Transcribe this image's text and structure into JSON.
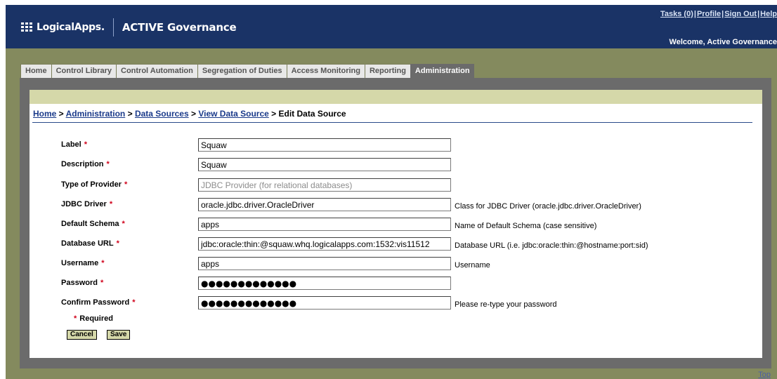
{
  "header": {
    "logo_text": "LogicalApps.",
    "product": "ACTIVE Governance",
    "links": [
      "Tasks (0)",
      "Profile",
      "Sign Out",
      "Help"
    ],
    "separator": "|",
    "welcome": "Welcome, Active Governance"
  },
  "tabs": [
    {
      "label": "Home",
      "active": false
    },
    {
      "label": "Control Library",
      "active": false
    },
    {
      "label": "Control Automation",
      "active": false
    },
    {
      "label": "Segregation of Duties",
      "active": false
    },
    {
      "label": "Access Monitoring",
      "active": false
    },
    {
      "label": "Reporting",
      "active": false
    },
    {
      "label": "Administration",
      "active": true
    }
  ],
  "breadcrumb": {
    "home": "Home",
    "administration": "Administration",
    "data_sources": "Data Sources",
    "view_data_source": "View Data Source",
    "current": "Edit Data Source",
    "sep": " > "
  },
  "form": {
    "required_marker": "*",
    "fields": [
      {
        "label": "Label",
        "value": "Squaw",
        "help": ""
      },
      {
        "label": "Description",
        "value": "Squaw",
        "help": ""
      },
      {
        "label": "Type of Provider",
        "value": "JDBC Provider (for relational databases)",
        "help": "",
        "disabled": true
      },
      {
        "label": "JDBC Driver",
        "value": "oracle.jdbc.driver.OracleDriver",
        "help": "Class for JDBC Driver (oracle.jdbc.driver.OracleDriver)"
      },
      {
        "label": "Default Schema",
        "value": "apps",
        "help": "Name of Default Schema (case sensitive)"
      },
      {
        "label": "Database URL",
        "value": "jdbc:oracle:thin:@squaw.whq.logicalapps.com:1532:vis11512",
        "help": "Database URL (i.e. jdbc:oracle:thin:@hostname:port:sid)"
      },
      {
        "label": "Username",
        "value": "apps",
        "help": "Username"
      },
      {
        "label": "Password",
        "value": "●●●●●●●●●●●●●",
        "help": ""
      },
      {
        "label": "Confirm Password",
        "value": "●●●●●●●●●●●●●",
        "help": "Please re-type your password"
      }
    ],
    "required_note": "Required",
    "cancel_label": "Cancel",
    "save_label": "Save"
  },
  "footer": {
    "top_link": "Top"
  }
}
